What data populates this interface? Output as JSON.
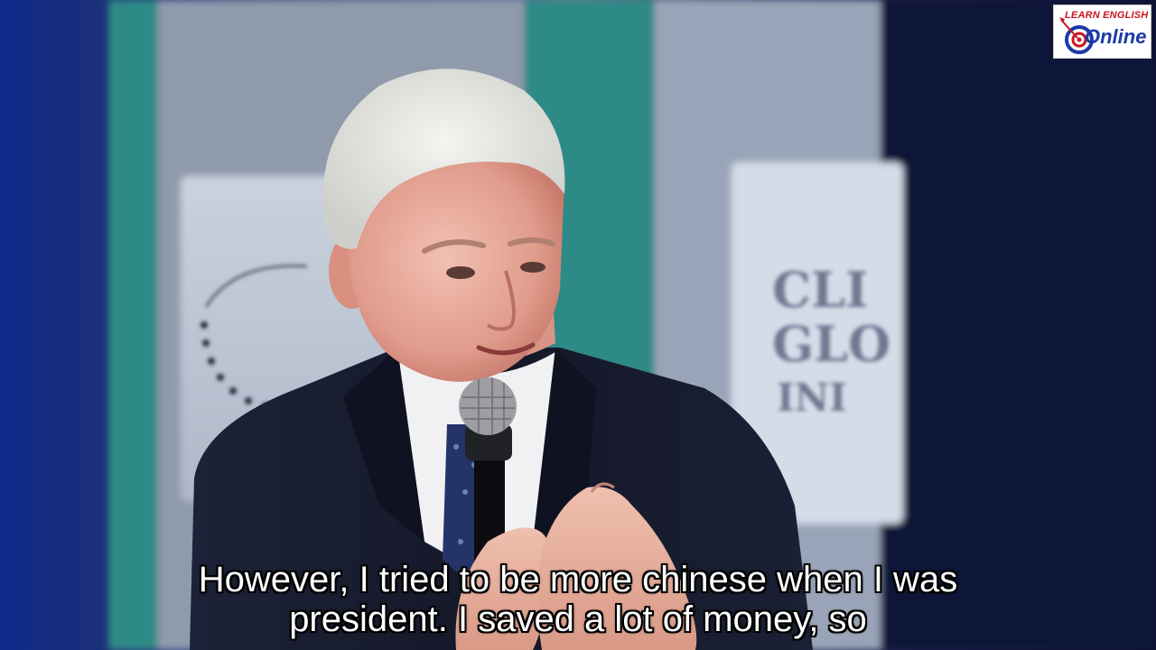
{
  "subtitles": {
    "line1": "However, I tried to be more chinese when I was",
    "line2": "president. I saved a lot of money, so"
  },
  "logo": {
    "top_text": "LEARN ENGLISH",
    "main_text": "Online"
  },
  "colors": {
    "background_blue": "#0a1540",
    "backdrop_teal": "#2e8a86",
    "suit": "#161a2c",
    "subtitle_text": "#ffffff",
    "logo_red": "#c8141e",
    "logo_blue": "#1c3aa8"
  }
}
